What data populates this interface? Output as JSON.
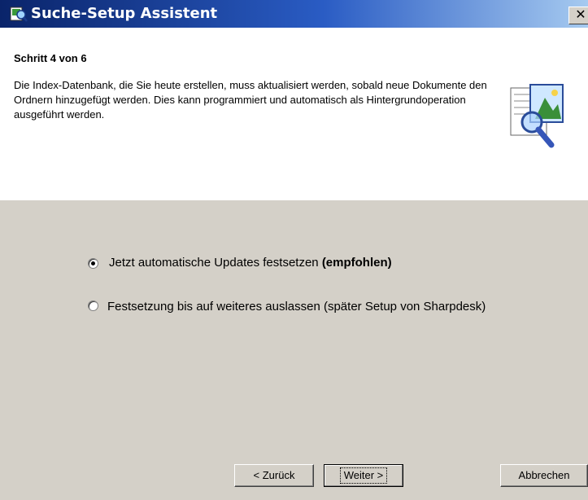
{
  "window": {
    "title": "Suche-Setup Assistent",
    "close_label": "✕"
  },
  "header": {
    "step": "Schritt 4 von 6",
    "description": "Die Index-Datenbank, die Sie heute erstellen, muss aktualisiert werden, sobald neue Dokumente den Ordnern hinzugefügt werden. Dies kann programmiert und automatisch als Hintergrundoperation ausgeführt werden."
  },
  "options": [
    {
      "label": "Jetzt automatische Updates festsetzen ",
      "emphasis": "(empfohlen)",
      "selected": true
    },
    {
      "label": "Festsetzung bis auf weiteres auslassen (später Setup von Sharpdesk)",
      "selected": false
    }
  ],
  "buttons": {
    "back": "< Zurück",
    "next": "Weiter >",
    "cancel": "Abbrechen"
  },
  "icons": {
    "title": "setup-wizard-icon",
    "header": "document-search-icon"
  }
}
